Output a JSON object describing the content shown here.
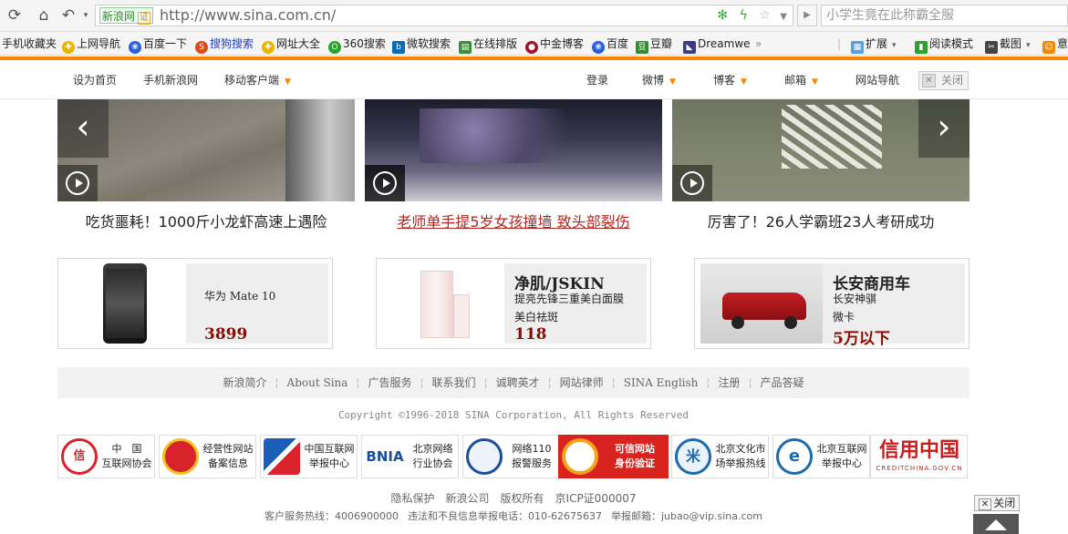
{
  "browser": {
    "site_tag": "新浪网",
    "cert_badge": "证",
    "url": "http://www.sina.com.cn/",
    "search_text": "小学生竟在此称霸全服",
    "nav_icons": [
      "refresh-icon",
      "home-icon",
      "undo-icon",
      "chevron-down-icon"
    ]
  },
  "bookmarks": {
    "items": [
      {
        "label": "手机收藏夹",
        "color": "#f5f5f5"
      },
      {
        "label": "上网导航",
        "color": "#e8b400"
      },
      {
        "label": "百度一下",
        "color": "#2b5fd9"
      },
      {
        "label": "搜狗搜索",
        "color": "#e04a1a"
      },
      {
        "label": "网址大全",
        "color": "#e8b400"
      },
      {
        "label": "360搜索",
        "color": "#2aa32a"
      },
      {
        "label": "微软搜索",
        "color": "#0b6bb5"
      },
      {
        "label": "在线排版",
        "color": "#3b8f3b"
      },
      {
        "label": "中金博客",
        "color": "#a0142a"
      },
      {
        "label": "百度",
        "color": "#2b5fd9"
      },
      {
        "label": "豆瓣",
        "color": "#2f8f2f"
      },
      {
        "label": "Dreamwe",
        "color": "#3a3a8a"
      }
    ],
    "more": "»",
    "right": [
      {
        "label": "扩展"
      },
      {
        "label": "阅读模式"
      },
      {
        "label": "截图"
      },
      {
        "label": "意"
      }
    ]
  },
  "sina_top": {
    "left": [
      "设为首页",
      "手机新浪网",
      "移动客户端"
    ],
    "right": [
      "登录",
      "微博",
      "博客",
      "邮箱",
      "网站导航"
    ],
    "close": "关闭"
  },
  "videos": [
    {
      "caption": "吃货噩耗！1000斤小龙虾高速上遇险",
      "highlight": false
    },
    {
      "caption": "老师单手提5岁女孩撞墙 致头部裂伤",
      "highlight": true
    },
    {
      "caption": "厉害了！26人学霸班23人考研成功",
      "highlight": false
    }
  ],
  "ads": [
    {
      "brand": "",
      "line1": "华为 Mate 10",
      "line2": "",
      "price": "3899"
    },
    {
      "brand": "净肌/JSKIN",
      "line1": "提亮先锋三重美白面膜",
      "line2": "美白祛斑",
      "price": "118"
    },
    {
      "brand": "长安商用车",
      "line1": "长安神骐",
      "line2": "微卡",
      "price": "5万以下"
    }
  ],
  "footer_links": [
    "新浪简介",
    "About Sina",
    "广告服务",
    "联系我们",
    "诚聘英才",
    "网站律师",
    "SINA English",
    "注册",
    "产品答疑"
  ],
  "copyright": "Copyright ©1996-2018 SINA Corporation, All Rights Reserved",
  "badges": [
    {
      "text": "中　国\n互联网协会",
      "color": "#d8232a"
    },
    {
      "text": "经营性网站\n备案信息",
      "color": "#d8232a"
    },
    {
      "text": "中国互联网\n举报中心",
      "color": "#1a5eb8"
    },
    {
      "text": "北京网络\n行业协会",
      "color": "#1a4fa0"
    },
    {
      "text": "网络110\n报警服务",
      "color": "#c02020"
    },
    {
      "text": "可信网站\n身份验证",
      "color": "#e03a1a"
    },
    {
      "text": "北京文化市\n场举报热线",
      "color": "#1a6bb0"
    },
    {
      "text": "北京互联网\n举报中心",
      "color": "#1a6bb0"
    },
    {
      "text": "信用中国",
      "color": "#c81e1e"
    }
  ],
  "bottom_links": [
    "隐私保护",
    "新浪公司",
    "版权所有",
    "京ICP证000007"
  ],
  "hotline": [
    "客户服务热线：4006900000",
    "违法和不良信息举报电话：010-62675637",
    "举报邮箱：jubao@vip.sina.com"
  ],
  "close_bottom": "关闭"
}
